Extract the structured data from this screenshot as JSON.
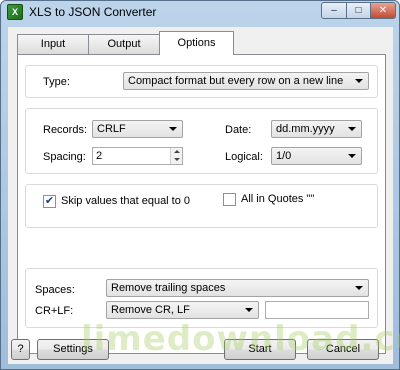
{
  "window": {
    "title": "XLS to JSON Converter"
  },
  "titlebar_buttons": {
    "minimize": "–",
    "maximize": "□",
    "close": "✕"
  },
  "tabs": [
    {
      "label": "Input"
    },
    {
      "label": "Output"
    },
    {
      "label": "Options"
    }
  ],
  "type_group": {
    "label": "Type:",
    "value": "Compact format but every row on a new line"
  },
  "records": {
    "label": "Records:",
    "value": "CRLF"
  },
  "date": {
    "label": "Date:",
    "value": "dd.mm.yyyy"
  },
  "spacing": {
    "label": "Spacing:",
    "value": "2"
  },
  "logical": {
    "label": "Logical:",
    "value": "1/0"
  },
  "skip_zero": {
    "label": "Skip values that equal to 0",
    "checked": true
  },
  "all_in_quotes": {
    "label": "All in Quotes \"\"",
    "checked": false
  },
  "spaces": {
    "label": "Spaces:",
    "value": "Remove trailing spaces"
  },
  "crlf": {
    "label": "CR+LF:",
    "value": "Remove CR, LF",
    "extra_value": ""
  },
  "footer": {
    "help_label": "?",
    "settings_label": "Settings",
    "start_label": "Start",
    "cancel_label": "Cancel"
  },
  "watermark": "limedownload.com"
}
